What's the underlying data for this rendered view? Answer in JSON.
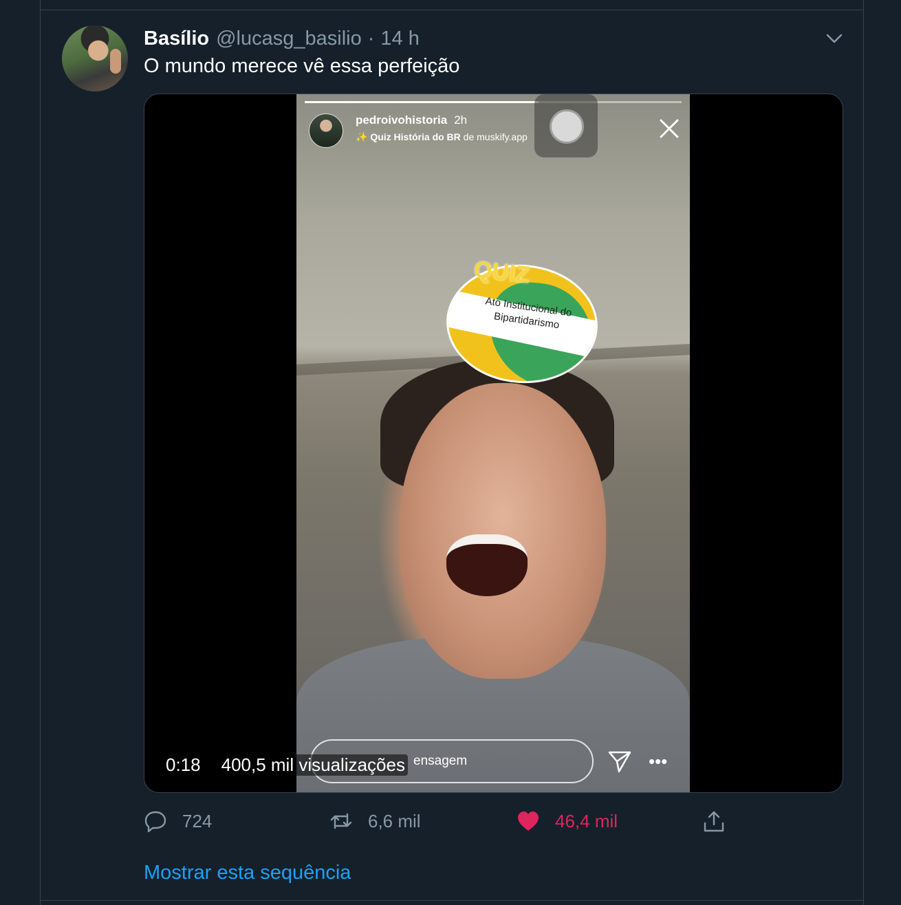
{
  "tweet": {
    "display_name": "Basílio",
    "handle": "@lucasg_basilio",
    "separator": "·",
    "time": "14 h",
    "text": "O mundo merece vê essa perfeição"
  },
  "story": {
    "username": "pedroivohistoria",
    "time": "2h",
    "effect_name": "Quiz História do BR",
    "effect_by": "de muskify.app",
    "progress_fraction": 0.62,
    "quiz_title": "QUIZ",
    "quiz_answer": "Ato Institucional do Bipartidarismo",
    "message_placeholder": "ensagem"
  },
  "video": {
    "time": "0:18",
    "views": "400,5 mil visualizações"
  },
  "actions": {
    "reply_count": "724",
    "retweet_count": "6,6 mil",
    "like_count": "46,4 mil"
  },
  "show_thread": "Mostrar esta sequência",
  "colors": {
    "background": "#15202b",
    "border": "#38444d",
    "secondary_text": "#8899a6",
    "link": "#1da1f2",
    "like": "#e0245e"
  },
  "icons": [
    "chevron-down-icon",
    "close-icon",
    "send-icon",
    "more-icon",
    "reply-icon",
    "retweet-icon",
    "heart-icon",
    "share-icon"
  ]
}
